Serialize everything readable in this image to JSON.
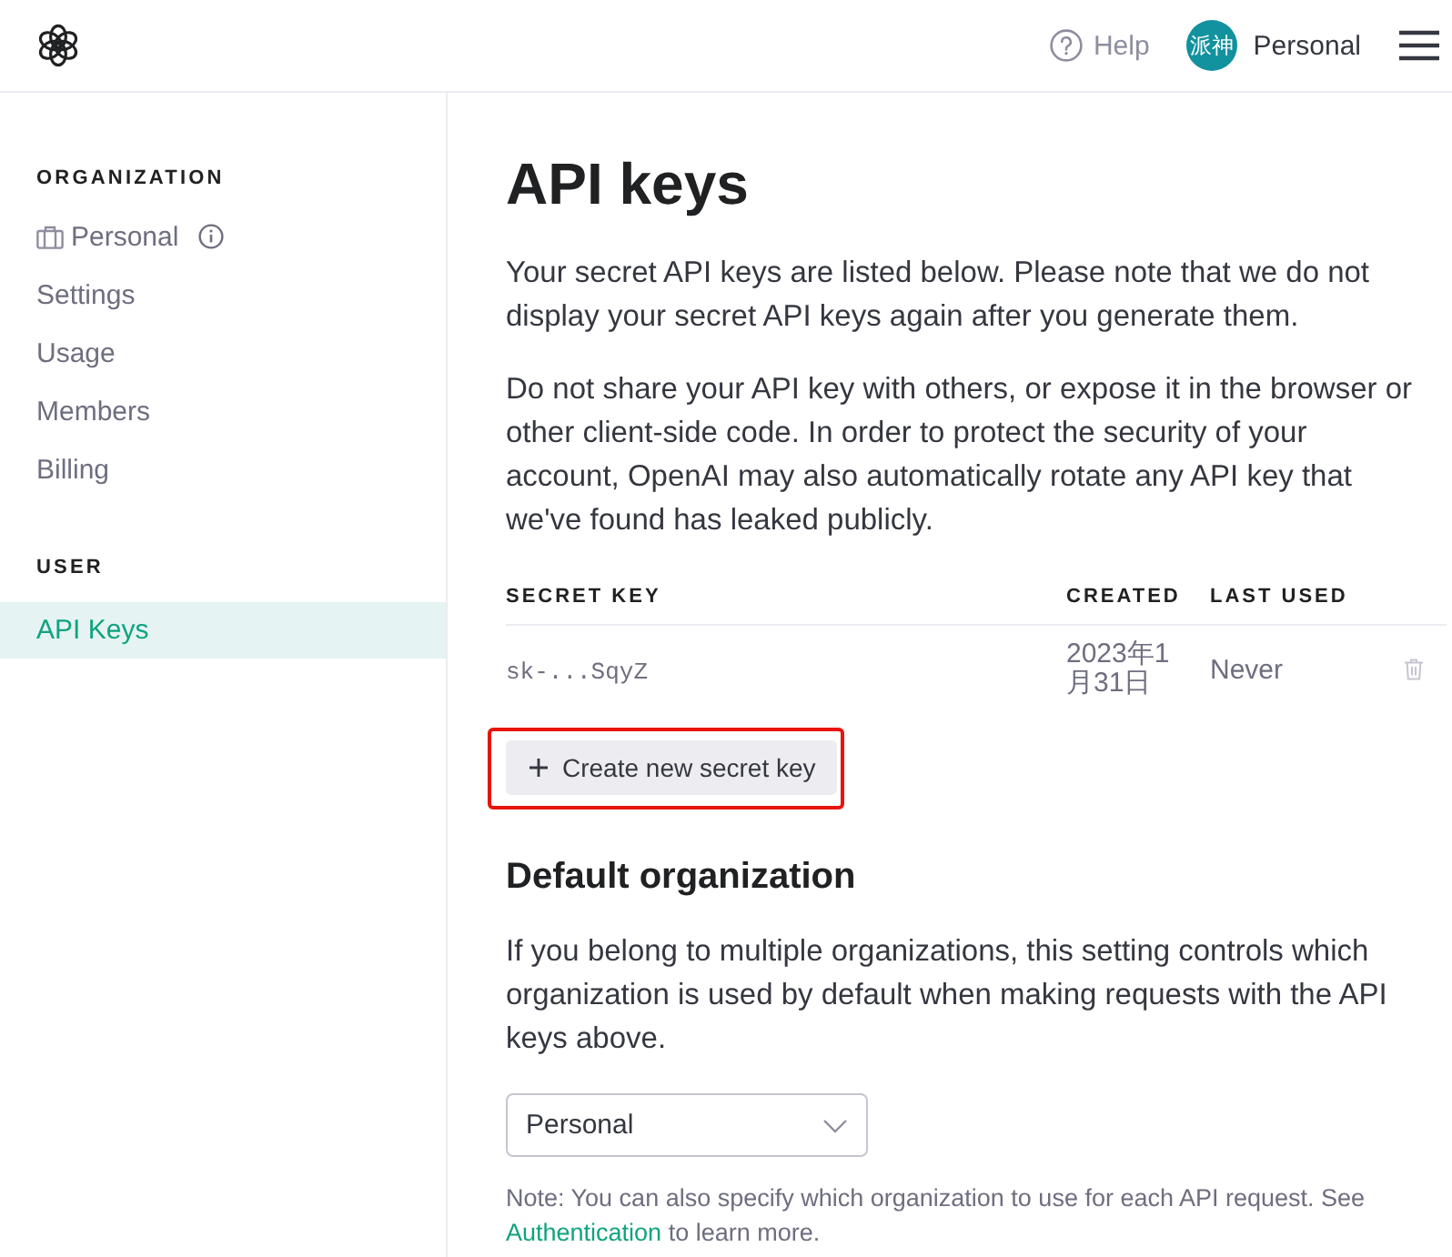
{
  "header": {
    "help": "Help",
    "avatar_text": "派神",
    "account": "Personal"
  },
  "sidebar": {
    "sections": [
      {
        "heading": "ORGANIZATION",
        "items": [
          {
            "label": "Personal",
            "kind": "organization",
            "selected": false
          },
          {
            "label": "Settings",
            "kind": "link",
            "selected": false
          },
          {
            "label": "Usage",
            "kind": "link",
            "selected": false
          },
          {
            "label": "Members",
            "kind": "link",
            "selected": false
          },
          {
            "label": "Billing",
            "kind": "link",
            "selected": false
          }
        ]
      },
      {
        "heading": "USER",
        "items": [
          {
            "label": "API Keys",
            "kind": "link",
            "selected": true
          }
        ]
      }
    ]
  },
  "main": {
    "title": "API keys",
    "paragraphs": [
      "Your secret API keys are listed below. Please note that we do not display your secret API keys again after you generate them.",
      "Do not share your API key with others, or expose it in the browser or other client-side code. In order to protect the security of your account, OpenAI may also automatically rotate any API key that we've found has leaked publicly."
    ],
    "table": {
      "columns": [
        "SECRET KEY",
        "CREATED",
        "LAST USED"
      ],
      "rows": [
        {
          "key": "sk-...SqyZ",
          "created": "2023年1月31日",
          "last_used": "Never"
        }
      ]
    },
    "create_button": {
      "label": "Create new secret key",
      "annotated": true
    },
    "default_org": {
      "heading": "Default organization",
      "text": "If you belong to multiple organizations, this setting controls which organization is used by default when making requests with the API keys above.",
      "select": {
        "value": "Personal"
      },
      "note": {
        "before": "Note: You can also specify which organization to use for each API request. See",
        "link": "Authentication",
        "after": "to learn more."
      }
    }
  }
}
